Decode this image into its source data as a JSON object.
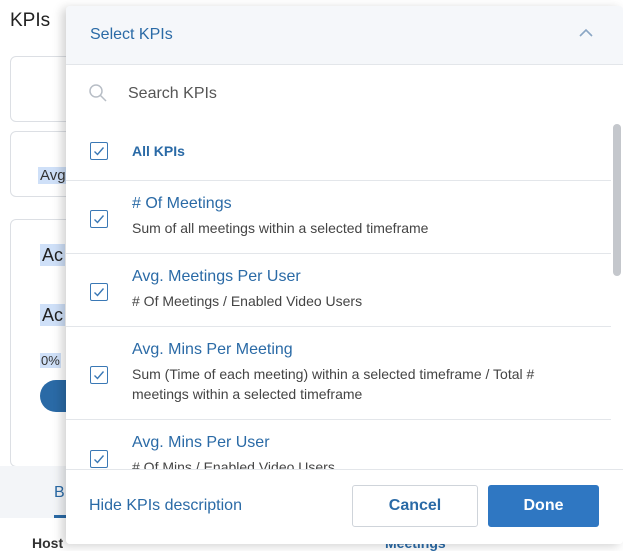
{
  "background": {
    "section_title": "KPIs",
    "card2_label": "Avg",
    "card3_label1": "Ac",
    "card3_label2": "Ac",
    "card3_percent": "0%",
    "tab_label": "B",
    "table_header_host": "Host",
    "table_header_meetings": "Meetings"
  },
  "dropdown": {
    "title": "Select KPIs",
    "search_placeholder": "Search KPIs",
    "items": [
      {
        "label": "All KPIs",
        "description": "",
        "checked": true
      },
      {
        "label": "# Of Meetings",
        "description": "Sum of all meetings within a selected timeframe",
        "checked": true
      },
      {
        "label": "Avg. Meetings Per User",
        "description": "# Of Meetings / Enabled Video Users",
        "checked": true
      },
      {
        "label": "Avg. Mins Per Meeting",
        "description": "Sum (Time of each meeting) within a selected timeframe / Total # meetings within a selected timeframe",
        "checked": true
      },
      {
        "label": "Avg. Mins Per User",
        "description": "# Of Mins / Enabled Video Users",
        "checked": true
      }
    ],
    "hide_description_link": "Hide KPIs description",
    "cancel_label": "Cancel",
    "done_label": "Done"
  },
  "colors": {
    "accent": "#2a6aa6",
    "primary_button": "#2f77c2",
    "highlight": "#cfe0f8"
  },
  "icons": {
    "header_toggle": "chevron-up-icon",
    "search": "search-icon",
    "checkbox": "checkmark-icon"
  }
}
